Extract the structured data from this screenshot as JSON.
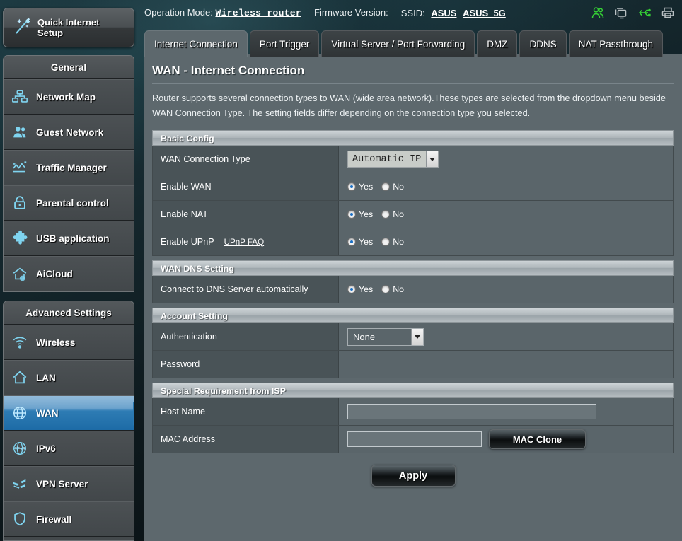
{
  "topbar": {
    "operation_mode_label": "Operation Mode:",
    "operation_mode_value": "Wireless router",
    "firmware_label": "Firmware Version:",
    "firmware_value": "",
    "ssid_label": "SSID:",
    "ssid_values": [
      "ASUS",
      "ASUS_5G"
    ],
    "icons": [
      "users-icon",
      "clients-icon",
      "usb-icon",
      "printer-icon"
    ]
  },
  "quick_setup": {
    "label_line1": "Quick Internet",
    "label_line2": "Setup",
    "icon": "magic-wand-icon"
  },
  "sidebar": {
    "general": {
      "title": "General",
      "items": [
        {
          "label": "Network Map",
          "icon": "network-map-icon"
        },
        {
          "label": "Guest Network",
          "icon": "guest-network-icon"
        },
        {
          "label": "Traffic Manager",
          "icon": "traffic-manager-icon"
        },
        {
          "label": "Parental control",
          "icon": "lock-icon"
        },
        {
          "label": "USB application",
          "icon": "puzzle-icon"
        },
        {
          "label": "AiCloud",
          "icon": "cloud-home-icon"
        }
      ]
    },
    "advanced": {
      "title": "Advanced Settings",
      "items": [
        {
          "label": "Wireless",
          "icon": "wifi-icon",
          "selected": false
        },
        {
          "label": "LAN",
          "icon": "home-icon",
          "selected": false
        },
        {
          "label": "WAN",
          "icon": "globe-icon",
          "selected": true
        },
        {
          "label": "IPv6",
          "icon": "ipv6-globe-icon",
          "selected": false
        },
        {
          "label": "VPN Server",
          "icon": "vpn-arrows-icon",
          "selected": false
        },
        {
          "label": "Firewall",
          "icon": "shield-icon",
          "selected": false
        }
      ]
    }
  },
  "tabs": [
    {
      "label": "Internet Connection",
      "active": true
    },
    {
      "label": "Port Trigger",
      "active": false
    },
    {
      "label": "Virtual Server / Port Forwarding",
      "active": false
    },
    {
      "label": "DMZ",
      "active": false
    },
    {
      "label": "DDNS",
      "active": false
    },
    {
      "label": "NAT Passthrough",
      "active": false
    }
  ],
  "main": {
    "title": "WAN - Internet Connection",
    "intro": "Router supports several connection types to WAN (wide area network).These types are selected from the dropdown menu beside WAN Connection Type. The setting fields differ depending on the connection type you selected.",
    "basic_config": {
      "heading": "Basic Config",
      "wan_connection_type": {
        "label": "WAN Connection Type",
        "value": "Automatic IP"
      },
      "enable_wan": {
        "label": "Enable WAN",
        "yes": "Yes",
        "no": "No",
        "selected": "Yes"
      },
      "enable_nat": {
        "label": "Enable NAT",
        "yes": "Yes",
        "no": "No",
        "selected": "Yes"
      },
      "enable_upnp": {
        "label": "Enable UPnP",
        "faq_link": "UPnP FAQ",
        "yes": "Yes",
        "no": "No",
        "selected": "Yes"
      }
    },
    "wan_dns": {
      "heading": "WAN DNS Setting",
      "auto_dns": {
        "label": "Connect to DNS Server automatically",
        "yes": "Yes",
        "no": "No",
        "selected": "Yes"
      }
    },
    "account_setting": {
      "heading": "Account Setting",
      "authentication": {
        "label": "Authentication",
        "value": "None"
      },
      "password": {
        "label": "Password",
        "value": ""
      }
    },
    "isp": {
      "heading": "Special Requirement from ISP",
      "host_name": {
        "label": "Host Name",
        "value": "",
        "placeholder": ""
      },
      "mac_address": {
        "label": "MAC Address",
        "value": "",
        "placeholder": ""
      },
      "mac_clone_button": "MAC Clone"
    },
    "apply_button": "Apply"
  },
  "colors": {
    "accent_blue": "#2e7cb4",
    "panel_bg": "#5d686d",
    "sidebar_bg": "#44494c",
    "icon_cyan": "#7fd4f0",
    "status_green": "#35d135"
  }
}
